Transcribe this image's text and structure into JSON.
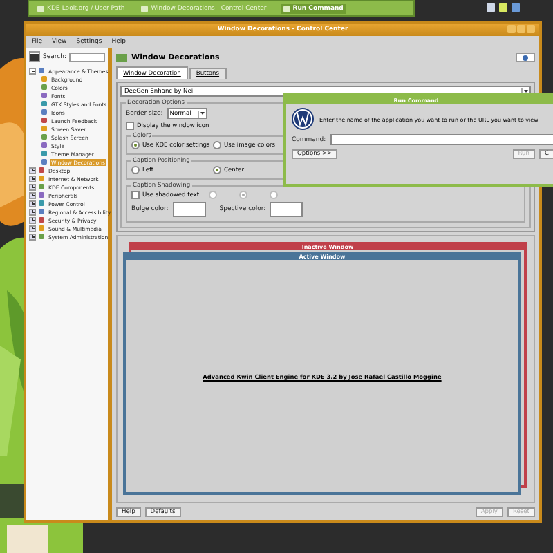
{
  "taskbar": {
    "tasks": [
      {
        "label": "KDE-Look.org / User Path",
        "selected": false
      },
      {
        "label": "Window Decorations - Control Center",
        "selected": false
      },
      {
        "label": "Run Command",
        "selected": true
      }
    ]
  },
  "control_center": {
    "title": "Window Decorations - Control Center",
    "menu": [
      "File",
      "View",
      "Settings",
      "Help"
    ],
    "search_label": "Search:",
    "tree": [
      {
        "label": "Appearance & Themes",
        "expanded": true,
        "selected": false,
        "children": [
          {
            "label": "Background",
            "selected": false
          },
          {
            "label": "Colors",
            "selected": false
          },
          {
            "label": "Fonts",
            "selected": false
          },
          {
            "label": "GTK Styles and Fonts",
            "selected": false
          },
          {
            "label": "Icons",
            "selected": false
          },
          {
            "label": "Launch Feedback",
            "selected": false
          },
          {
            "label": "Screen Saver",
            "selected": false
          },
          {
            "label": "Splash Screen",
            "selected": false
          },
          {
            "label": "Style",
            "selected": false
          },
          {
            "label": "Theme Manager",
            "selected": false
          },
          {
            "label": "Window Decorations",
            "selected": true
          }
        ]
      },
      {
        "label": "Desktop",
        "expanded": false,
        "selected": false
      },
      {
        "label": "Internet & Network",
        "expanded": false,
        "selected": false
      },
      {
        "label": "KDE Components",
        "expanded": false,
        "selected": false
      },
      {
        "label": "Peripherals",
        "expanded": false,
        "selected": false
      },
      {
        "label": "Power Control",
        "expanded": false,
        "selected": false
      },
      {
        "label": "Regional & Accessibility",
        "expanded": false,
        "selected": false
      },
      {
        "label": "Security & Privacy",
        "expanded": false,
        "selected": false
      },
      {
        "label": "Sound & Multimedia",
        "expanded": false,
        "selected": false
      },
      {
        "label": "System Administration",
        "expanded": false,
        "selected": false
      }
    ],
    "page_title": "Window Decorations",
    "tabs": [
      {
        "label": "Window Decoration",
        "selected": true
      },
      {
        "label": "Buttons",
        "selected": false
      }
    ],
    "decoration": "DeeGen Enhanc by Neil",
    "options_title": "Decoration Options",
    "border_size": {
      "label": "Border size:",
      "value": "Normal"
    },
    "display_icon": {
      "label": "Display the window icon",
      "checked": false
    },
    "colors": {
      "title": "Colors",
      "options": [
        {
          "label": "Use KDE color settings",
          "selected": true
        },
        {
          "label": "Use image colors",
          "selected": false
        }
      ]
    },
    "caption_positioning": {
      "title": "Caption Positioning",
      "options": [
        {
          "label": "Left",
          "selected": false
        },
        {
          "label": "Center",
          "selected": true
        }
      ]
    },
    "caption_shadowing": {
      "title": "Caption Shadowing",
      "checkbox": {
        "label": "Use shadowed text",
        "checked": false
      },
      "radios": [
        {
          "selected": false
        },
        {
          "selected": true
        },
        {
          "selected": false
        }
      ],
      "fields": [
        "Bulge color:",
        "Spective color:"
      ]
    },
    "preview": {
      "inactive_title": "Inactive Window",
      "active_title": "Active Window",
      "text": "Advanced Kwin Client Engine for KDE 3.2 by Jose Rafael Castillo Moggine"
    },
    "buttons": [
      {
        "label": "Help",
        "disabled": false
      },
      {
        "label": "Defaults",
        "disabled": false
      },
      {
        "label": "Apply",
        "disabled": true
      },
      {
        "label": "Reset",
        "disabled": true
      }
    ]
  },
  "run_command": {
    "title": "Run Command",
    "prompt": "Enter the name of the application you want to run or the URL you want to view",
    "command_label": "Command:",
    "buttons": [
      {
        "label": "Options >>",
        "disabled": false
      },
      {
        "label": "Run",
        "disabled": true
      },
      {
        "label": "C",
        "disabled": false
      }
    ]
  }
}
